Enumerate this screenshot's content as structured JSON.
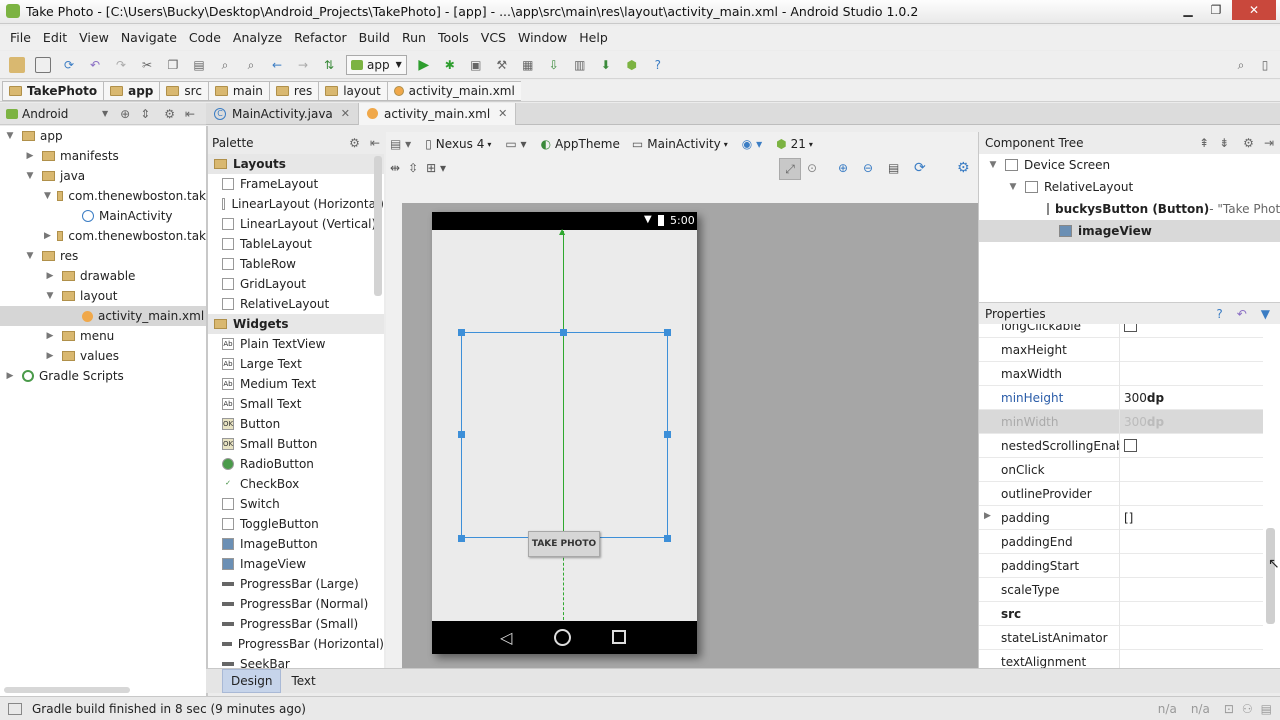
{
  "window": {
    "title": "Take Photo - [C:\\Users\\Bucky\\Desktop\\Android_Projects\\TakePhoto] - [app] - ...\\app\\src\\main\\res\\layout\\activity_main.xml - Android Studio 1.0.2"
  },
  "menu": [
    "File",
    "Edit",
    "View",
    "Navigate",
    "Code",
    "Analyze",
    "Refactor",
    "Build",
    "Run",
    "Tools",
    "VCS",
    "Window",
    "Help"
  ],
  "toolbar": {
    "run_config": "app"
  },
  "breadcrumb": [
    "TakePhoto",
    "app",
    "src",
    "main",
    "res",
    "layout",
    "activity_main.xml"
  ],
  "project": {
    "view_selector": "Android",
    "tree": [
      {
        "label": "app",
        "level": 0,
        "arrow": "▼",
        "bold": false
      },
      {
        "label": "manifests",
        "level": 1,
        "arrow": "▶"
      },
      {
        "label": "java",
        "level": 1,
        "arrow": "▼"
      },
      {
        "label": "com.thenewboston.tak",
        "level": 2,
        "arrow": "▼"
      },
      {
        "label": "MainActivity",
        "level": 3,
        "arrow": ""
      },
      {
        "label": "com.thenewboston.tak",
        "level": 2,
        "arrow": "▶"
      },
      {
        "label": "res",
        "level": 1,
        "arrow": "▼"
      },
      {
        "label": "drawable",
        "level": 2,
        "arrow": "▶"
      },
      {
        "label": "layout",
        "level": 2,
        "arrow": "▼"
      },
      {
        "label": "activity_main.xml",
        "level": 3,
        "arrow": ""
      },
      {
        "label": "menu",
        "level": 2,
        "arrow": "▶"
      },
      {
        "label": "values",
        "level": 2,
        "arrow": "▶"
      },
      {
        "label": "Gradle Scripts",
        "level": 0,
        "arrow": "▶"
      }
    ]
  },
  "editor_tabs": [
    {
      "label": "MainActivity.java",
      "active": false
    },
    {
      "label": "activity_main.xml",
      "active": true
    }
  ],
  "palette": {
    "title": "Palette",
    "groups": [
      {
        "name": "Layouts",
        "items": [
          "FrameLayout",
          "LinearLayout (Horizontal)",
          "LinearLayout (Vertical)",
          "TableLayout",
          "TableRow",
          "GridLayout",
          "RelativeLayout"
        ]
      },
      {
        "name": "Widgets",
        "items": [
          "Plain TextView",
          "Large Text",
          "Medium Text",
          "Small Text",
          "Button",
          "Small Button",
          "RadioButton",
          "CheckBox",
          "Switch",
          "ToggleButton",
          "ImageButton",
          "ImageView",
          "ProgressBar (Large)",
          "ProgressBar (Normal)",
          "ProgressBar (Small)",
          "ProgressBar (Horizontal)",
          "SeekBar"
        ]
      }
    ]
  },
  "designer": {
    "device": "Nexus 4",
    "theme": "AppTheme",
    "activity": "MainActivity",
    "api": "21",
    "clock": "5:00",
    "button_text": "TAKE PHOTO"
  },
  "component_tree": {
    "title": "Component Tree",
    "items": [
      {
        "label": "Device Screen",
        "sub": ""
      },
      {
        "label": "RelativeLayout",
        "sub": ""
      },
      {
        "label": "buckysButton (Button)",
        "sub": " - \"Take Photo\""
      },
      {
        "label": "imageView",
        "sub": ""
      }
    ]
  },
  "properties": {
    "title": "Properties",
    "rows": [
      {
        "key": "longClickable",
        "value": "",
        "checkbox": true
      },
      {
        "key": "maxHeight",
        "value": ""
      },
      {
        "key": "maxWidth",
        "value": ""
      },
      {
        "key": "minHeight",
        "value": "300dp",
        "blue": true
      },
      {
        "key": "minWidth",
        "value": "300dp",
        "selected": true
      },
      {
        "key": "nestedScrollingEnabled",
        "value": "",
        "checkbox": true
      },
      {
        "key": "onClick",
        "value": ""
      },
      {
        "key": "outlineProvider",
        "value": ""
      },
      {
        "key": "padding",
        "value": "[]",
        "expand": true
      },
      {
        "key": "paddingEnd",
        "value": ""
      },
      {
        "key": "paddingStart",
        "value": ""
      },
      {
        "key": "scaleType",
        "value": ""
      },
      {
        "key": "src",
        "value": "",
        "bold": true
      },
      {
        "key": "stateListAnimator",
        "value": ""
      },
      {
        "key": "textAlignment",
        "value": ""
      }
    ]
  },
  "bottom_tabs": [
    "Design",
    "Text"
  ],
  "status": {
    "message": "Gradle build finished in 8 sec (9 minutes ago)",
    "right1": "n/a",
    "right2": "n/a"
  }
}
